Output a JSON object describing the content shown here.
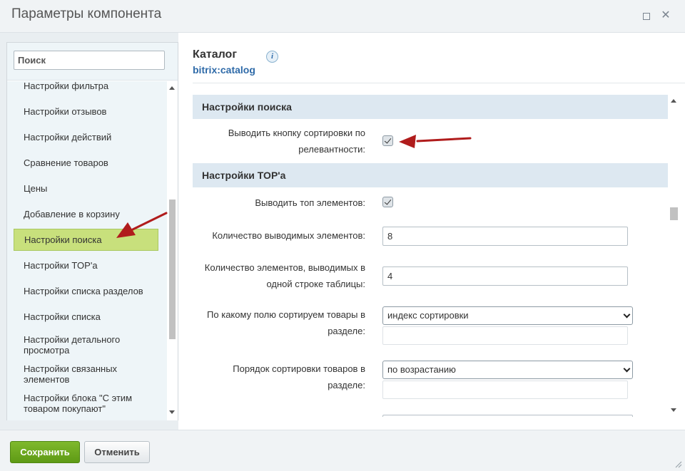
{
  "window": {
    "title": "Параметры компонента",
    "maximize_icon": "maximize-icon",
    "close_icon": "close-icon",
    "close_glyph": "✕"
  },
  "sidebar": {
    "search_placeholder": "Поиск",
    "items": [
      {
        "label": "Настройки фильтра",
        "active": false
      },
      {
        "label": "Настройки отзывов",
        "active": false
      },
      {
        "label": "Настройки действий",
        "active": false
      },
      {
        "label": "Сравнение товаров",
        "active": false
      },
      {
        "label": "Цены",
        "active": false
      },
      {
        "label": "Добавление в корзину",
        "active": false
      },
      {
        "label": "Настройки поиска",
        "active": true
      },
      {
        "label": "Настройки TOP'a",
        "active": false
      },
      {
        "label": "Настройки списка разделов",
        "active": false
      },
      {
        "label": "Настройки списка",
        "active": false
      },
      {
        "label": "Настройки детального просмотра",
        "active": false
      },
      {
        "label": "Настройки связанных элементов",
        "active": false
      },
      {
        "label": "Настройки блока \"С этим товаром покупают\"",
        "active": false
      }
    ]
  },
  "component": {
    "name": "Каталог",
    "code": "bitrix:catalog",
    "info_glyph": "i"
  },
  "sections": [
    {
      "title": "Настройки поиска",
      "rows": [
        {
          "label": "Выводить кнопку сортировки по релевантности:",
          "type": "checkbox",
          "checked": true
        }
      ]
    },
    {
      "title": "Настройки TOP'a",
      "rows": [
        {
          "label": "Выводить топ элементов:",
          "type": "checkbox",
          "checked": true
        },
        {
          "label": "Количество выводимых элементов:",
          "type": "text",
          "value": "8"
        },
        {
          "label": "Количество элементов, выводимых в одной строке таблицы:",
          "type": "text",
          "value": "4"
        },
        {
          "label": "По какому полю сортируем товары в разделе:",
          "type": "select",
          "value": "индекс сортировки"
        },
        {
          "label": "Порядок сортировки товаров в разделе:",
          "type": "select",
          "value": "по возрастанию"
        }
      ]
    }
  ],
  "footer": {
    "save_label": "Сохранить",
    "cancel_label": "Отменить"
  },
  "colors": {
    "active_item": "#c8e07c",
    "section_header": "#dde8f1",
    "save_button": "#6aa81f",
    "arrow": "#b01c1c",
    "link": "#2e6aa8"
  }
}
